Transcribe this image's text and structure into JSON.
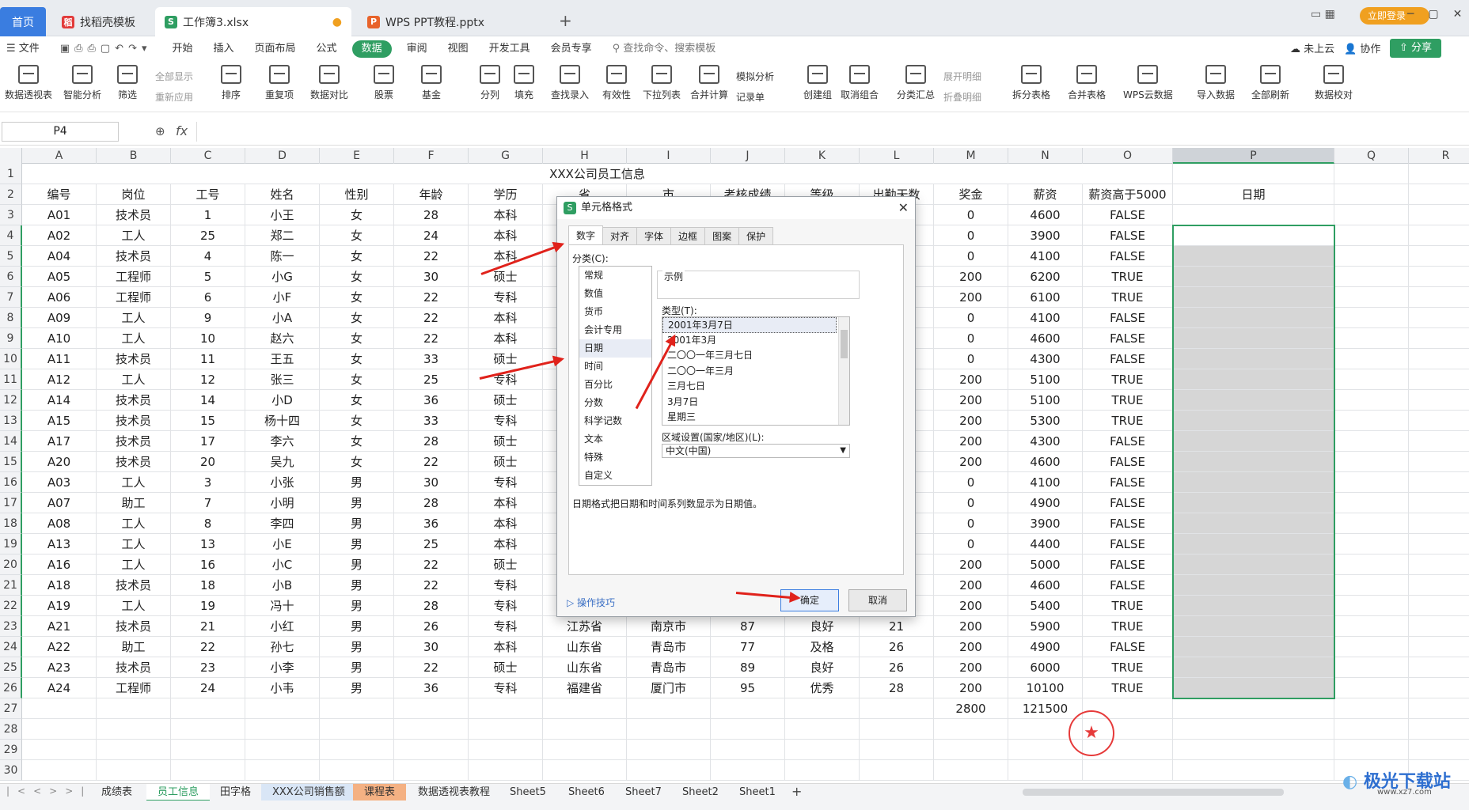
{
  "tabs": {
    "home": "首页",
    "t1": "找稻壳模板",
    "t2": "工作簿3.xlsx",
    "t3": "WPS PPT教程.pptx",
    "login": "立即登录"
  },
  "menu": [
    "文件",
    "开始",
    "插入",
    "页面布局",
    "公式",
    "数据",
    "审阅",
    "视图",
    "开发工具",
    "会员专享"
  ],
  "menu_search": "查找命令、搜索模板",
  "menu_right": {
    "cloud": "未上云",
    "collab": "协作",
    "share": "分享"
  },
  "toolbar": [
    "数据透视表",
    "智能分析",
    "筛选",
    "排序",
    "重复项",
    "数据对比",
    "股票",
    "基金",
    "分列",
    "填充",
    "查找录入",
    "有效性",
    "下拉列表",
    "合并计算",
    "创建组",
    "取消组合",
    "分类汇总",
    "拆分表格",
    "合并表格",
    "WPS云数据",
    "导入数据",
    "全部刷新",
    "数据校对"
  ],
  "toolbar_small": {
    "showall": "全部显示",
    "reapply": "重新应用",
    "simulate": "模拟分析",
    "record": "记录单",
    "expand": "展开明细",
    "collapse": "折叠明细"
  },
  "formula": {
    "cell": "P4",
    "fx": "fx"
  },
  "columns": [
    "A",
    "B",
    "C",
    "D",
    "E",
    "F",
    "G",
    "H",
    "I",
    "J",
    "K",
    "L",
    "M",
    "N",
    "O",
    "P",
    "Q",
    "R"
  ],
  "title": "XXX公司员工信息",
  "headers": [
    "编号",
    "岗位",
    "工号",
    "姓名",
    "性别",
    "年龄",
    "学历",
    "省",
    "市",
    "考核成绩",
    "等级",
    "出勤天数",
    "奖金",
    "薪资",
    "薪资高于5000",
    "日期"
  ],
  "rows": [
    [
      "A01",
      "技术员",
      "1",
      "小王",
      "女",
      "28",
      "本科",
      "",
      "",
      "",
      "",
      "",
      "0",
      "4600",
      "FALSE"
    ],
    [
      "A02",
      "工人",
      "25",
      "郑二",
      "女",
      "24",
      "本科",
      "",
      "",
      "",
      "",
      "",
      "0",
      "3900",
      "FALSE"
    ],
    [
      "A04",
      "技术员",
      "4",
      "陈一",
      "女",
      "22",
      "本科",
      "",
      "",
      "",
      "",
      "",
      "0",
      "4100",
      "FALSE"
    ],
    [
      "A05",
      "工程师",
      "5",
      "小G",
      "女",
      "30",
      "硕士",
      "",
      "",
      "",
      "",
      "",
      "200",
      "6200",
      "TRUE"
    ],
    [
      "A06",
      "工程师",
      "6",
      "小F",
      "女",
      "22",
      "专科",
      "",
      "",
      "",
      "",
      "",
      "200",
      "6100",
      "TRUE"
    ],
    [
      "A09",
      "工人",
      "9",
      "小A",
      "女",
      "22",
      "本科",
      "",
      "",
      "",
      "",
      "",
      "0",
      "4100",
      "FALSE"
    ],
    [
      "A10",
      "工人",
      "10",
      "赵六",
      "女",
      "22",
      "本科",
      "",
      "",
      "",
      "",
      "",
      "0",
      "4600",
      "FALSE"
    ],
    [
      "A11",
      "技术员",
      "11",
      "王五",
      "女",
      "33",
      "硕士",
      "",
      "",
      "",
      "",
      "",
      "0",
      "4300",
      "FALSE"
    ],
    [
      "A12",
      "工人",
      "12",
      "张三",
      "女",
      "25",
      "专科",
      "",
      "",
      "",
      "",
      "",
      "200",
      "5100",
      "TRUE"
    ],
    [
      "A14",
      "技术员",
      "14",
      "小D",
      "女",
      "36",
      "硕士",
      "",
      "",
      "",
      "",
      "",
      "200",
      "5100",
      "TRUE"
    ],
    [
      "A15",
      "技术员",
      "15",
      "杨十四",
      "女",
      "33",
      "专科",
      "",
      "",
      "",
      "",
      "",
      "200",
      "5300",
      "TRUE"
    ],
    [
      "A17",
      "技术员",
      "17",
      "李六",
      "女",
      "28",
      "硕士",
      "",
      "",
      "",
      "",
      "",
      "200",
      "4300",
      "FALSE"
    ],
    [
      "A20",
      "技术员",
      "20",
      "吴九",
      "女",
      "22",
      "硕士",
      "",
      "",
      "",
      "",
      "",
      "200",
      "4600",
      "FALSE"
    ],
    [
      "A03",
      "工人",
      "3",
      "小张",
      "男",
      "30",
      "专科",
      "",
      "",
      "",
      "",
      "",
      "0",
      "4100",
      "FALSE"
    ],
    [
      "A07",
      "助工",
      "7",
      "小明",
      "男",
      "28",
      "本科",
      "",
      "",
      "",
      "",
      "",
      "0",
      "4900",
      "FALSE"
    ],
    [
      "A08",
      "工人",
      "8",
      "李四",
      "男",
      "36",
      "本科",
      "",
      "",
      "",
      "",
      "",
      "0",
      "3900",
      "FALSE"
    ],
    [
      "A13",
      "工人",
      "13",
      "小E",
      "男",
      "25",
      "本科",
      "",
      "",
      "",
      "",
      "",
      "0",
      "4400",
      "FALSE"
    ],
    [
      "A16",
      "工人",
      "16",
      "小C",
      "男",
      "22",
      "硕士",
      "",
      "",
      "",
      "",
      "",
      "200",
      "5000",
      "FALSE"
    ],
    [
      "A18",
      "技术员",
      "18",
      "小B",
      "男",
      "22",
      "专科",
      "",
      "",
      "",
      "",
      "",
      "200",
      "4600",
      "FALSE"
    ],
    [
      "A19",
      "工人",
      "19",
      "冯十",
      "男",
      "28",
      "专科",
      "",
      "",
      "",
      "",
      "",
      "200",
      "5400",
      "TRUE"
    ],
    [
      "A21",
      "技术员",
      "21",
      "小红",
      "男",
      "26",
      "专科",
      "江苏省",
      "南京市",
      "87",
      "良好",
      "21",
      "200",
      "5900",
      "TRUE"
    ],
    [
      "A22",
      "助工",
      "22",
      "孙七",
      "男",
      "30",
      "本科",
      "山东省",
      "青岛市",
      "77",
      "及格",
      "26",
      "200",
      "4900",
      "FALSE"
    ],
    [
      "A23",
      "技术员",
      "23",
      "小李",
      "男",
      "22",
      "硕士",
      "山东省",
      "青岛市",
      "89",
      "良好",
      "26",
      "200",
      "6000",
      "TRUE"
    ],
    [
      "A24",
      "工程师",
      "24",
      "小韦",
      "男",
      "36",
      "专科",
      "福建省",
      "厦门市",
      "95",
      "优秀",
      "28",
      "200",
      "10100",
      "TRUE"
    ]
  ],
  "totals": {
    "bonus": "2800",
    "salary": "121500"
  },
  "sheet_tabs": [
    "成绩表",
    "员工信息",
    "田字格",
    "XXX公司销售额",
    "课程表",
    "数据透视表教程",
    "Sheet5",
    "Sheet6",
    "Sheet7",
    "Sheet2",
    "Sheet1"
  ],
  "dialog": {
    "title": "单元格格式",
    "tabs": [
      "数字",
      "对齐",
      "字体",
      "边框",
      "图案",
      "保护"
    ],
    "category_label": "分类(C):",
    "categories": [
      "常规",
      "数值",
      "货币",
      "会计专用",
      "日期",
      "时间",
      "百分比",
      "分数",
      "科学记数",
      "文本",
      "特殊",
      "自定义"
    ],
    "sample_label": "示例",
    "type_label": "类型(T):",
    "types": [
      "2001年3月7日",
      "2001年3月",
      "二〇〇一年三月七日",
      "二〇〇一年三月",
      "三月七日",
      "3月7日",
      "星期三"
    ],
    "locale_label": "区域设置(国家/地区)(L):",
    "locale_value": "中文(中国)",
    "description": "日期格式把日期和时间系列数显示为日期值。",
    "tips": "操作技巧",
    "ok": "确定",
    "cancel": "取消"
  },
  "watermark": "极光下载站",
  "watermark_url": "www.xz7.com"
}
